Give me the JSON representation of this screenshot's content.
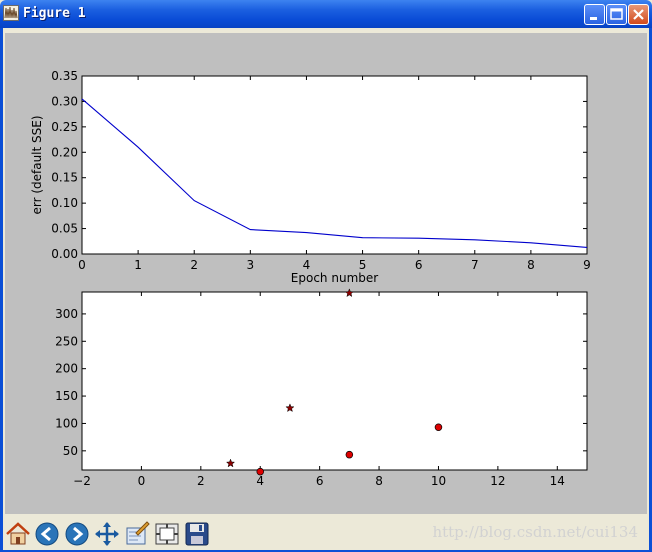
{
  "window": {
    "title": "Figure 1",
    "icons": {
      "app": "matplotlib-icon",
      "minimize": "minimize-icon",
      "maximize": "maximize-icon",
      "close": "close-icon"
    }
  },
  "toolbar": {
    "buttons": [
      {
        "name": "home-button",
        "icon": "home-icon"
      },
      {
        "name": "back-button",
        "icon": "back-arrow-icon"
      },
      {
        "name": "forward-button",
        "icon": "forward-arrow-icon"
      },
      {
        "name": "pan-button",
        "icon": "pan-arrows-icon"
      },
      {
        "name": "zoom-button",
        "icon": "zoom-rect-icon"
      },
      {
        "name": "subplots-button",
        "icon": "subplots-icon"
      },
      {
        "name": "save-button",
        "icon": "floppy-disk-icon"
      }
    ]
  },
  "watermark": "http://blog.csdn.net/cui134",
  "colors": {
    "figure_bg": "#bfbfbf",
    "axes_bg": "#ffffff",
    "line": "#0000cc",
    "scatter_circle": "#dd0000",
    "scatter_star": "#8b0000"
  },
  "chart_data": [
    {
      "type": "line",
      "title": "",
      "xlabel": "Epoch number",
      "ylabel": "err (default SSE)",
      "xlim": [
        0,
        9
      ],
      "ylim": [
        0,
        0.35
      ],
      "xticks": [
        "0",
        "1",
        "2",
        "3",
        "4",
        "5",
        "6",
        "7",
        "8",
        "9"
      ],
      "yticks": [
        "0.00",
        "0.05",
        "0.10",
        "0.15",
        "0.20",
        "0.25",
        "0.30",
        "0.35"
      ],
      "grid": false,
      "series": [
        {
          "x": [
            0,
            1,
            2,
            3,
            4,
            5,
            6,
            7,
            8,
            9
          ],
          "y": [
            0.305,
            0.21,
            0.105,
            0.048,
            0.042,
            0.032,
            0.031,
            0.028,
            0.022,
            0.013
          ],
          "color": "#0000cc"
        }
      ]
    },
    {
      "type": "scatter",
      "title": "",
      "xlabel": "",
      "ylabel": "",
      "xlim": [
        -2,
        15
      ],
      "ylim": [
        15,
        340
      ],
      "xticks": [
        "−2",
        "0",
        "2",
        "4",
        "6",
        "8",
        "10",
        "12",
        "14"
      ],
      "yticks": [
        "50",
        "100",
        "150",
        "200",
        "250",
        "300"
      ],
      "grid": false,
      "series": [
        {
          "marker": "star",
          "color": "#8b0000",
          "x": [
            3,
            5,
            7
          ],
          "y": [
            27,
            128,
            338
          ]
        },
        {
          "marker": "circle",
          "color": "#dd0000",
          "x": [
            4,
            7,
            10
          ],
          "y": [
            12,
            43,
            93
          ]
        }
      ]
    }
  ]
}
